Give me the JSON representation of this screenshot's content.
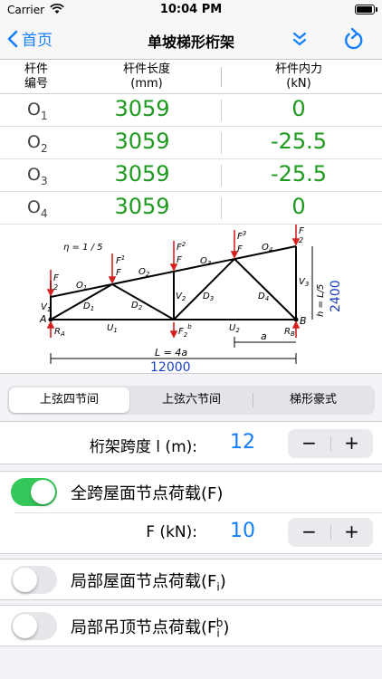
{
  "status": {
    "carrier": "Carrier",
    "time": "10:04 PM"
  },
  "nav": {
    "back_label": "首页",
    "title": "单坡梯形桁架"
  },
  "table": {
    "headers": {
      "number_line1": "杆件",
      "number_line2": "编号",
      "length_line1": "杆件长度",
      "length_line2": "(mm)",
      "force_line1": "杆件内力",
      "force_line2": "(kN)"
    },
    "rows": [
      {
        "id": "O",
        "sub": "1",
        "length": "3059",
        "force": "0"
      },
      {
        "id": "O",
        "sub": "2",
        "length": "3059",
        "force": "-25.5"
      },
      {
        "id": "O",
        "sub": "3",
        "length": "3059",
        "force": "-25.5"
      },
      {
        "id": "O",
        "sub": "4",
        "length": "3059",
        "force": "0"
      }
    ]
  },
  "diagram": {
    "eta": "η = 1 / 5",
    "h_label": "h = L/5",
    "height_value": "2400",
    "span_label": "L = 4a",
    "span_value": "12000",
    "a_label": "a",
    "labels": {
      "O1": "O",
      "O1s": "1",
      "O2": "O",
      "O2s": "2",
      "O3": "O",
      "O3s": "3",
      "O4": "O",
      "O4s": "4",
      "D1": "D",
      "D1s": "1",
      "D2": "D",
      "D2s": "2",
      "D3": "D",
      "D3s": "3",
      "D4": "D",
      "D4s": "4",
      "V1": "V",
      "V1s": "1",
      "V2": "V",
      "V2s": "2",
      "V3": "V",
      "V3s": "3",
      "U1": "U",
      "U1s": "1",
      "U2": "U",
      "U2s": "2",
      "A": "A",
      "B": "B",
      "RA": "R",
      "RAs": "A",
      "RB": "R",
      "RBs": "B",
      "F": "F",
      "F1": "F",
      "F1s": "1",
      "F2": "F",
      "F2s": "2",
      "F3": "F",
      "F3s": "3",
      "Fhalf": "F",
      "Fhalf_d": "2",
      "F2b": "F",
      "F2bs": "2",
      "F2bsup": "b"
    }
  },
  "segments": {
    "items": [
      "上弦四节间",
      "上弦六节间",
      "梯形豪式"
    ],
    "selected": 0
  },
  "span": {
    "label": "桁架跨度 l (m):",
    "value": "12",
    "minus": "−",
    "plus": "+"
  },
  "load_full": {
    "label": "全跨屋面节点荷载(F)",
    "on": true
  },
  "force": {
    "label": "F (kN):",
    "value": "10",
    "minus": "−",
    "plus": "+"
  },
  "load_partial": {
    "label_main": "局部屋面节点荷载(F",
    "label_sub": "i",
    "label_end": ")",
    "on": false
  },
  "load_ceiling": {
    "label_main": "局部吊顶节点荷载(F",
    "label_sub": "i",
    "label_sup": "b",
    "label_end": ")",
    "on": false
  },
  "colors": {
    "accent": "#147efb",
    "value_green": "#1e9a1e",
    "toggle_on": "#34c759",
    "load_red": "#d62020",
    "dimension_blue": "#1a3fbf"
  }
}
